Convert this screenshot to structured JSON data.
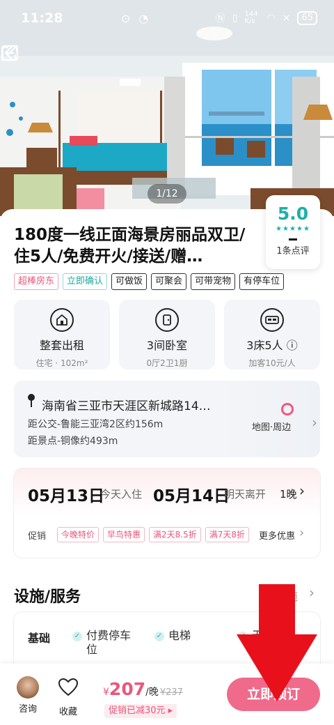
{
  "status_bar": {
    "time": "11:28",
    "network_speed": "144 K/s",
    "battery": "65"
  },
  "gallery": {
    "counter": "1/12"
  },
  "listing": {
    "title": "180度一线正面海景房丽品双卫/住5人/免费开火/接送/赠…",
    "rating": {
      "score": "5.0",
      "stars": "★★★★★",
      "reviews": "1条点评"
    },
    "tags": [
      {
        "label": "超棒房东",
        "style": "pink"
      },
      {
        "label": "立即确认",
        "style": "teal"
      },
      {
        "label": "可做饭",
        "style": "plain"
      },
      {
        "label": "可聚会",
        "style": "plain"
      },
      {
        "label": "可带宠物",
        "style": "plain"
      },
      {
        "label": "有停车位",
        "style": "plain"
      }
    ]
  },
  "features": [
    {
      "icon": "house-icon",
      "title": "整套出租",
      "sub": "住宅 · 102m²"
    },
    {
      "icon": "door-icon",
      "title": "3间卧室",
      "sub": "0厅2卫1厨"
    },
    {
      "icon": "bed-icon",
      "title": "3床5人 ⓘ",
      "sub": "加客10元/人"
    }
  ],
  "location": {
    "address": "海南省三亚市天涯区新城路14…",
    "bus": "距公交-鲁能三亚湾2区约156m",
    "spot": "距景点-铜像约493m",
    "map_link": "地图·周边"
  },
  "stay": {
    "checkin": "05月13日",
    "checkin_label": "今天入住",
    "checkout": "05月14日",
    "checkout_label": "明天离开",
    "nights": "1晚",
    "promo_label": "促销",
    "promos": [
      "今晚特价",
      "早鸟特惠",
      "满2天8.5折",
      "满7天8折"
    ],
    "more": "更多优惠"
  },
  "facilities": {
    "title": "设施/服务",
    "more": "施",
    "category": "基础",
    "items": [
      "付费停车\n位",
      "电梯",
      "无"
    ]
  },
  "bottom_bar": {
    "consult": "咨询",
    "favorite": "收藏",
    "currency": "¥",
    "price": "207",
    "per": "/晚",
    "original": "¥237",
    "saving": "促销已减30元 ▸",
    "book": "立即预订"
  },
  "colors": {
    "accent": "#f06a8c",
    "teal": "#1bb0a8"
  }
}
